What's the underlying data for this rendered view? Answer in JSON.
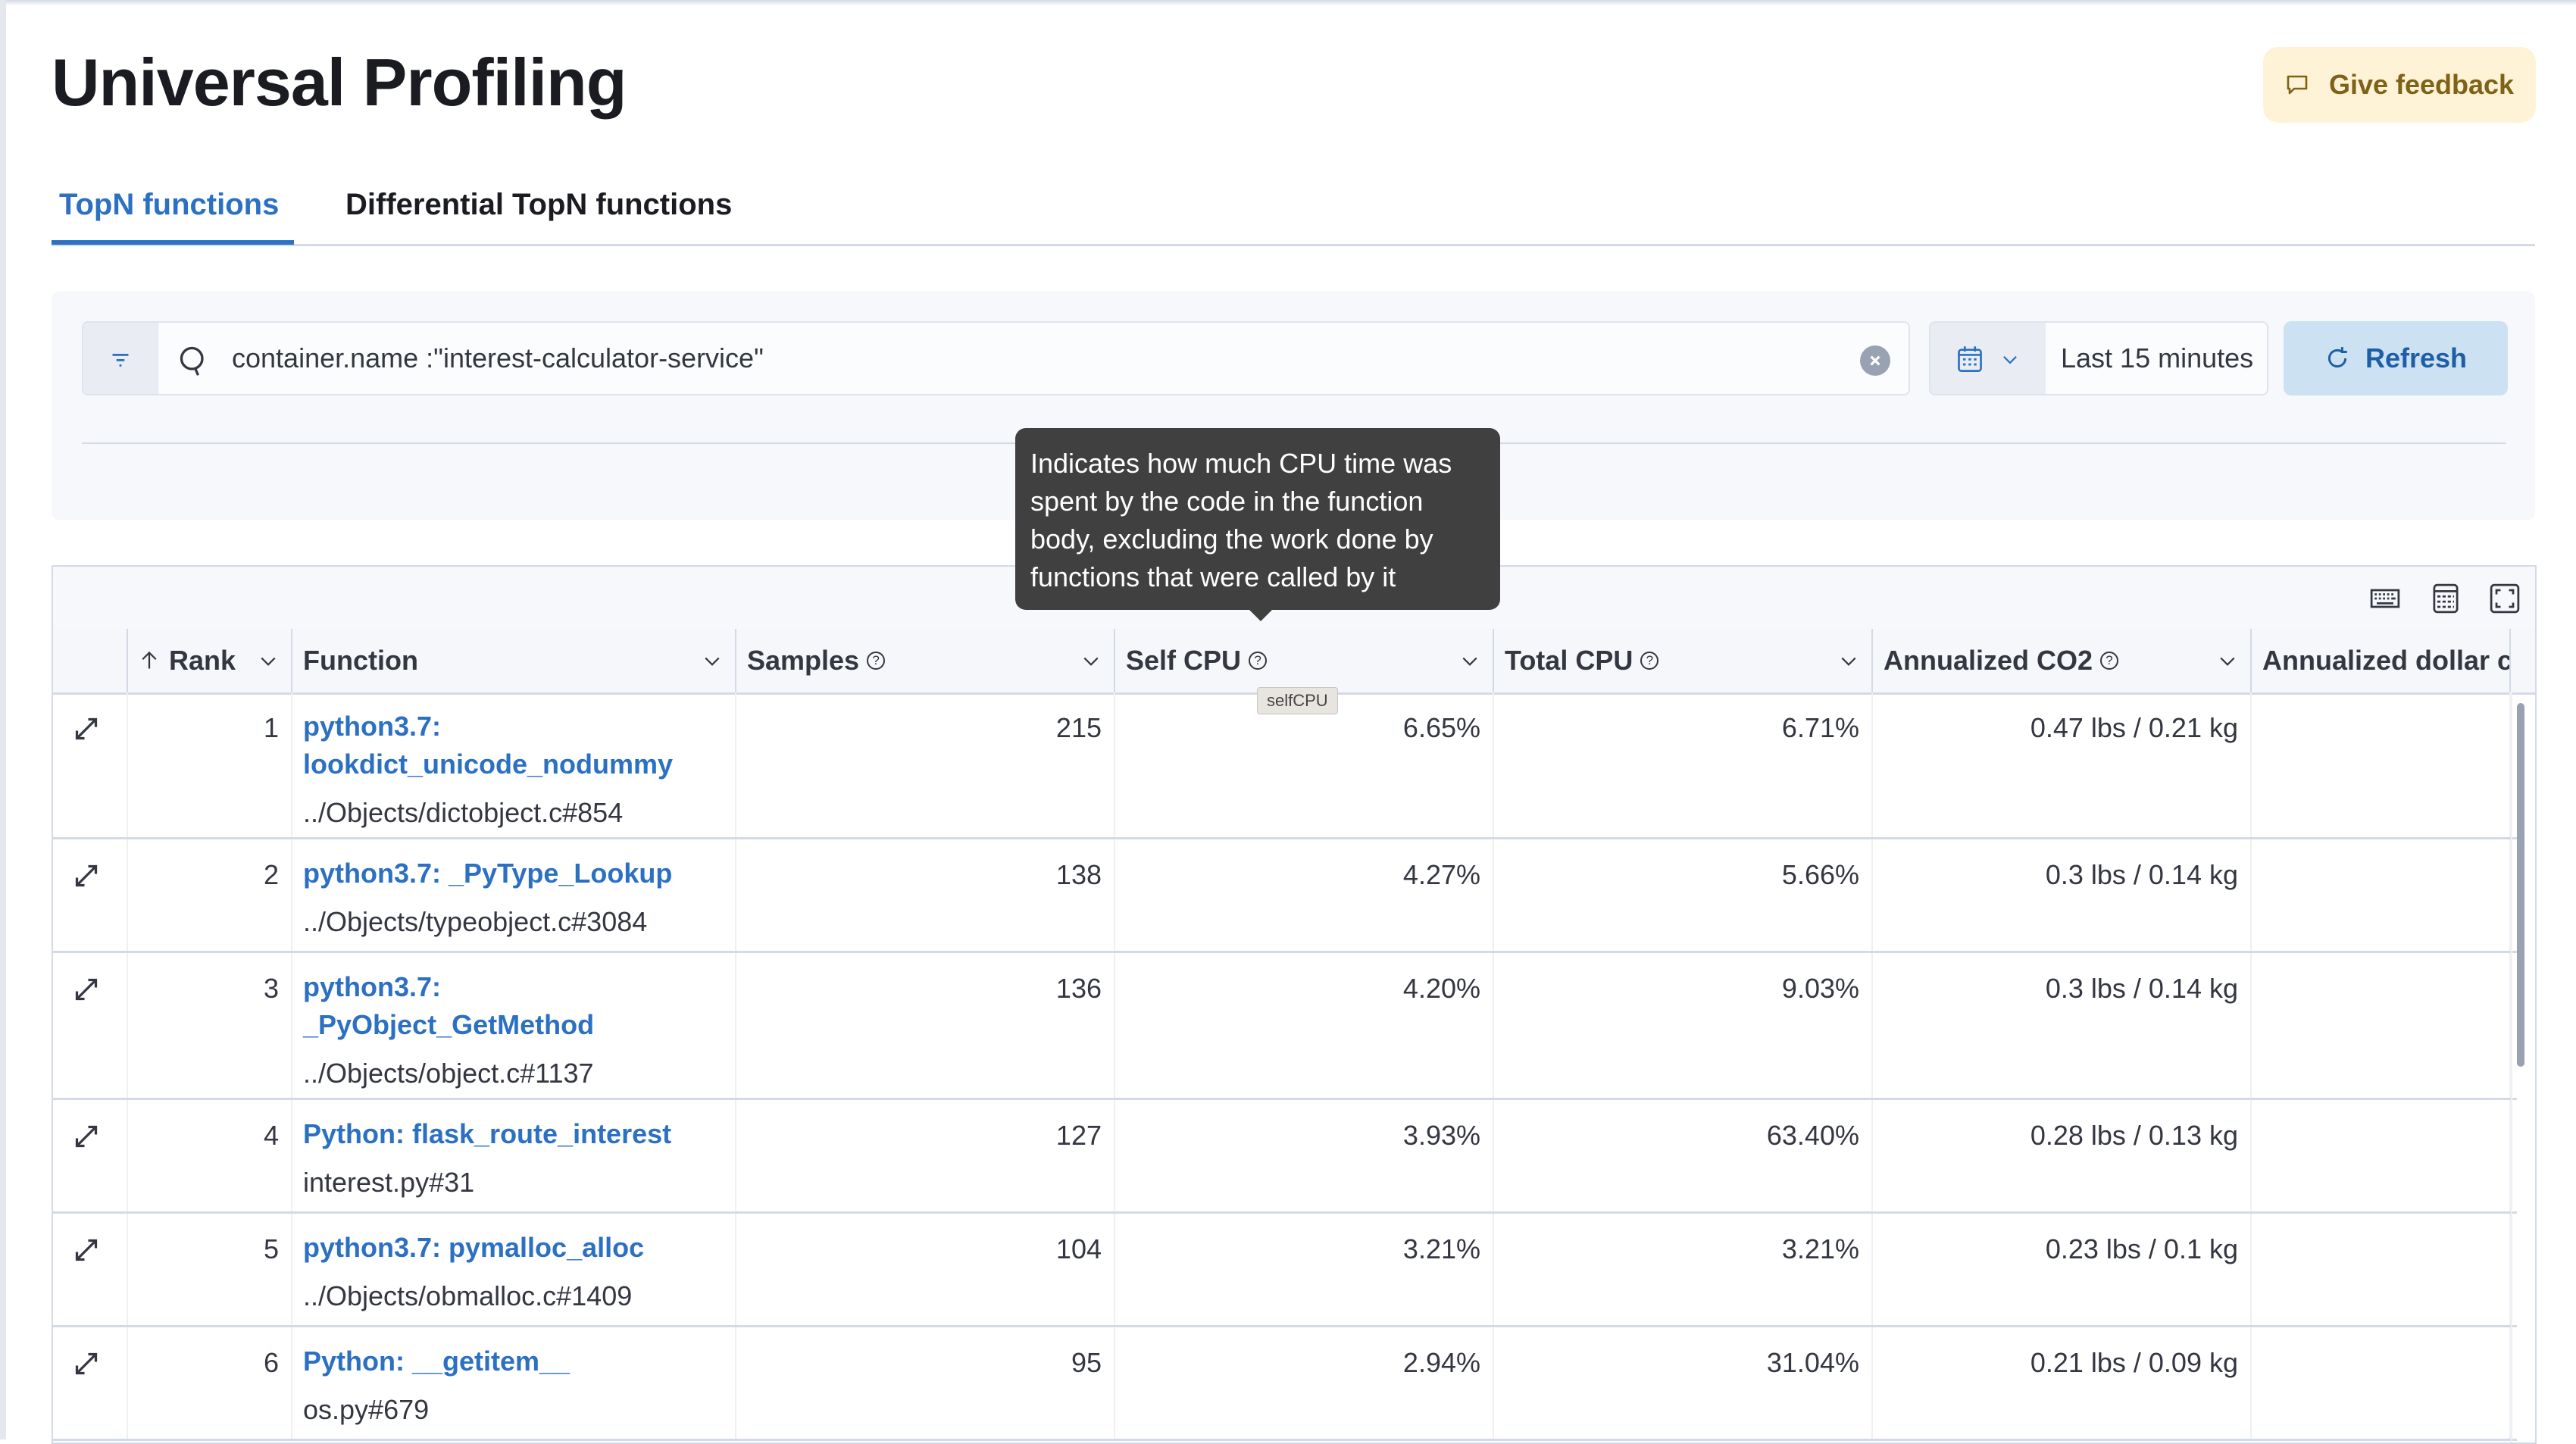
{
  "page": {
    "title": "Universal Profiling",
    "feedback_label": "Give feedback"
  },
  "tabs": [
    {
      "label": "TopN functions",
      "active": true
    },
    {
      "label": "Differential TopN functions",
      "active": false
    }
  ],
  "filter": {
    "query": "container.name :\"interest-calculator-service\"",
    "time_range": "Last 15 minutes",
    "refresh_label": "Refresh"
  },
  "table": {
    "toolbar_icons": [
      "keyboard-shortcuts-icon",
      "display-density-icon",
      "fullscreen-icon"
    ],
    "columns": [
      {
        "label": "Rank",
        "sort": "ascending",
        "help": false
      },
      {
        "label": "Function",
        "help": false
      },
      {
        "label": "Samples",
        "help": true
      },
      {
        "label": "Self CPU",
        "help": true
      },
      {
        "label": "Total CPU",
        "help": true
      },
      {
        "label": "Annualized CO2",
        "help": true
      },
      {
        "label": "Annualized dollar c",
        "help": false
      }
    ],
    "rows": [
      {
        "rank": "1",
        "function_line1": "python3.7:",
        "function_line2": "lookdict_unicode_nodummy",
        "source": "../Objects/dictobject.c#854",
        "samples": "215",
        "self_cpu": "6.65%",
        "total_cpu": "6.71%",
        "co2": "0.47 lbs / 0.21 kg",
        "dollar": ""
      },
      {
        "rank": "2",
        "function_line1": "python3.7: _PyType_Lookup",
        "function_line2": "",
        "source": "../Objects/typeobject.c#3084",
        "samples": "138",
        "self_cpu": "4.27%",
        "total_cpu": "5.66%",
        "co2": "0.3 lbs / 0.14 kg",
        "dollar": ""
      },
      {
        "rank": "3",
        "function_line1": "python3.7:",
        "function_line2": "_PyObject_GetMethod",
        "source": "../Objects/object.c#1137",
        "samples": "136",
        "self_cpu": "4.20%",
        "total_cpu": "9.03%",
        "co2": "0.3 lbs / 0.14 kg",
        "dollar": ""
      },
      {
        "rank": "4",
        "function_line1": "Python: flask_route_interest",
        "function_line2": "",
        "source": "interest.py#31",
        "samples": "127",
        "self_cpu": "3.93%",
        "total_cpu": "63.40%",
        "co2": "0.28 lbs / 0.13 kg",
        "dollar": ""
      },
      {
        "rank": "5",
        "function_line1": "python3.7: pymalloc_alloc",
        "function_line2": "",
        "source": "../Objects/obmalloc.c#1409",
        "samples": "104",
        "self_cpu": "3.21%",
        "total_cpu": "3.21%",
        "co2": "0.23 lbs / 0.1 kg",
        "dollar": ""
      },
      {
        "rank": "6",
        "function_line1": "Python: __getitem__",
        "function_line2": "",
        "source": "os.py#679",
        "samples": "95",
        "self_cpu": "2.94%",
        "total_cpu": "31.04%",
        "co2": "0.21 lbs / 0.09 kg",
        "dollar": ""
      }
    ]
  },
  "tooltip": {
    "text": "Indicates how much CPU time was spent by the code in the function body, excluding the work done by functions that were called by it",
    "mini_tip": "selfCPU"
  },
  "colors": {
    "accent": "#2b70c3",
    "feedback_bg": "#fef3d6",
    "feedback_text": "#7f6117",
    "refresh_bg": "#cce1f2",
    "tooltip_bg": "#404040"
  }
}
